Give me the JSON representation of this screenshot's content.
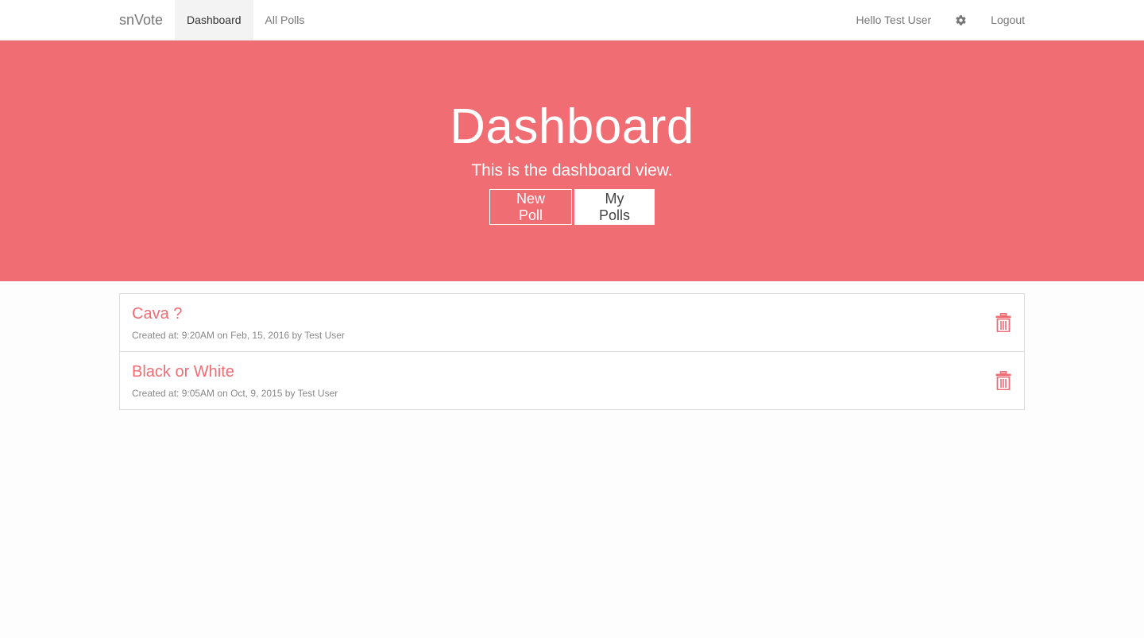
{
  "nav": {
    "brand": "snVote",
    "links": [
      {
        "label": "Dashboard",
        "active": true
      },
      {
        "label": "All Polls",
        "active": false
      }
    ],
    "greeting": "Hello Test User",
    "settings_icon": "gear-icon",
    "logout": "Logout"
  },
  "hero": {
    "title": "Dashboard",
    "subtitle": "This is the dashboard view.",
    "buttons": {
      "new_poll": "New Poll",
      "my_polls": "My Polls"
    }
  },
  "polls": [
    {
      "title": "Cava ?",
      "meta": "Created at: 9:20AM on Feb, 15, 2016 by Test User",
      "action_icon": "trash-icon"
    },
    {
      "title": "Black or White",
      "meta": "Created at: 9:05AM on Oct, 9, 2015 by Test User",
      "action_icon": "trash-icon"
    }
  ],
  "colors": {
    "accent": "#ef6d73",
    "hero_text": "#ffffff",
    "nav_active_bg": "#f3f3f3",
    "border": "#dddddd"
  }
}
